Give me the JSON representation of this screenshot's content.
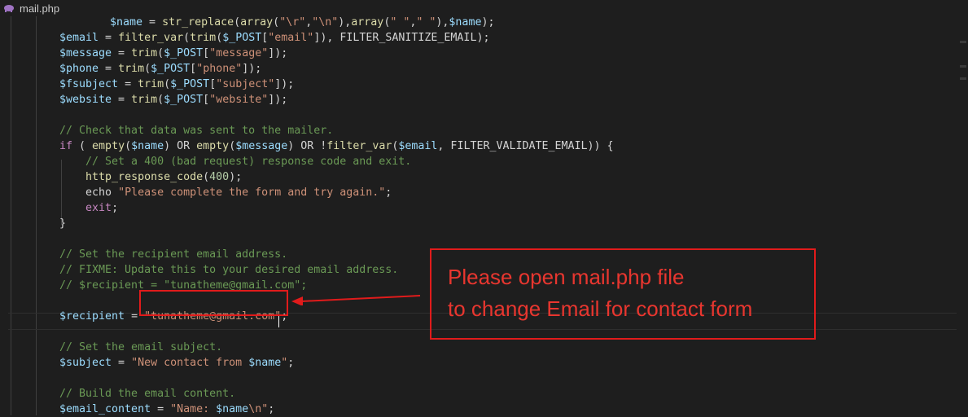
{
  "tab": {
    "filename": "mail.php",
    "icon": "php-elephant-icon"
  },
  "colors": {
    "annotation": "#e11b1b",
    "background": "#1e1e1e"
  },
  "code_lines": [
    [
      {
        "t": "$name",
        "c": "v"
      },
      {
        "t": " = ",
        "c": "p"
      },
      {
        "t": "str_replace",
        "c": "f"
      },
      {
        "t": "(",
        "c": "p"
      },
      {
        "t": "array",
        "c": "f"
      },
      {
        "t": "(",
        "c": "p"
      },
      {
        "t": "\"\\r\"",
        "c": "s"
      },
      {
        "t": ",",
        "c": "p"
      },
      {
        "t": "\"\\n\"",
        "c": "s"
      },
      {
        "t": "),",
        "c": "p"
      },
      {
        "t": "array",
        "c": "f"
      },
      {
        "t": "(",
        "c": "p"
      },
      {
        "t": "\" \"",
        "c": "s"
      },
      {
        "t": ",",
        "c": "p"
      },
      {
        "t": "\" \"",
        "c": "s"
      },
      {
        "t": "),",
        "c": "p"
      },
      {
        "t": "$name",
        "c": "v"
      },
      {
        "t": ");",
        "c": "p"
      }
    ],
    [
      {
        "t": "$email",
        "c": "v"
      },
      {
        "t": " = ",
        "c": "p"
      },
      {
        "t": "filter_var",
        "c": "f"
      },
      {
        "t": "(",
        "c": "p"
      },
      {
        "t": "trim",
        "c": "f"
      },
      {
        "t": "(",
        "c": "p"
      },
      {
        "t": "$_POST",
        "c": "v"
      },
      {
        "t": "[",
        "c": "p"
      },
      {
        "t": "\"email\"",
        "c": "s"
      },
      {
        "t": "]), FILTER_SANITIZE_EMAIL);",
        "c": "p"
      }
    ],
    [
      {
        "t": "$message",
        "c": "v"
      },
      {
        "t": " = ",
        "c": "p"
      },
      {
        "t": "trim",
        "c": "f"
      },
      {
        "t": "(",
        "c": "p"
      },
      {
        "t": "$_POST",
        "c": "v"
      },
      {
        "t": "[",
        "c": "p"
      },
      {
        "t": "\"message\"",
        "c": "s"
      },
      {
        "t": "]);",
        "c": "p"
      }
    ],
    [
      {
        "t": "$phone",
        "c": "v"
      },
      {
        "t": " = ",
        "c": "p"
      },
      {
        "t": "trim",
        "c": "f"
      },
      {
        "t": "(",
        "c": "p"
      },
      {
        "t": "$_POST",
        "c": "v"
      },
      {
        "t": "[",
        "c": "p"
      },
      {
        "t": "\"phone\"",
        "c": "s"
      },
      {
        "t": "]);",
        "c": "p"
      }
    ],
    [
      {
        "t": "$fsubject",
        "c": "v"
      },
      {
        "t": " = ",
        "c": "p"
      },
      {
        "t": "trim",
        "c": "f"
      },
      {
        "t": "(",
        "c": "p"
      },
      {
        "t": "$_POST",
        "c": "v"
      },
      {
        "t": "[",
        "c": "p"
      },
      {
        "t": "\"subject\"",
        "c": "s"
      },
      {
        "t": "]);",
        "c": "p"
      }
    ],
    [
      {
        "t": "$website",
        "c": "v"
      },
      {
        "t": " = ",
        "c": "p"
      },
      {
        "t": "trim",
        "c": "f"
      },
      {
        "t": "(",
        "c": "p"
      },
      {
        "t": "$_POST",
        "c": "v"
      },
      {
        "t": "[",
        "c": "p"
      },
      {
        "t": "\"website\"",
        "c": "s"
      },
      {
        "t": "]);",
        "c": "p"
      }
    ],
    [],
    [
      {
        "t": "// Check that data was sent to the mailer.",
        "c": "c"
      }
    ],
    [
      {
        "t": "if",
        "c": "k"
      },
      {
        "t": " ( ",
        "c": "p"
      },
      {
        "t": "empty",
        "c": "f"
      },
      {
        "t": "(",
        "c": "p"
      },
      {
        "t": "$name",
        "c": "v"
      },
      {
        "t": ") OR ",
        "c": "p"
      },
      {
        "t": "empty",
        "c": "f"
      },
      {
        "t": "(",
        "c": "p"
      },
      {
        "t": "$message",
        "c": "v"
      },
      {
        "t": ") OR !",
        "c": "p"
      },
      {
        "t": "filter_var",
        "c": "f"
      },
      {
        "t": "(",
        "c": "p"
      },
      {
        "t": "$email",
        "c": "v"
      },
      {
        "t": ", FILTER_VALIDATE_EMAIL)) {",
        "c": "p"
      }
    ],
    [
      {
        "t": "    // Set a 400 (bad request) response code and exit.",
        "c": "c"
      }
    ],
    [
      {
        "t": "    ",
        "c": "p"
      },
      {
        "t": "http_response_code",
        "c": "f"
      },
      {
        "t": "(",
        "c": "p"
      },
      {
        "t": "400",
        "c": "n"
      },
      {
        "t": ");",
        "c": "p"
      }
    ],
    [
      {
        "t": "    echo ",
        "c": "p"
      },
      {
        "t": "\"Please complete the form and try again.\"",
        "c": "s"
      },
      {
        "t": ";",
        "c": "p"
      }
    ],
    [
      {
        "t": "    ",
        "c": "p"
      },
      {
        "t": "exit",
        "c": "k"
      },
      {
        "t": ";",
        "c": "p"
      }
    ],
    [
      {
        "t": "}",
        "c": "p"
      }
    ],
    [],
    [
      {
        "t": "// Set the recipient email address.",
        "c": "c"
      }
    ],
    [
      {
        "t": "// FIXME: Update this to your desired email address.",
        "c": "c"
      }
    ],
    [
      {
        "t": "// $recipient = \"tunatheme@gmail.com\";",
        "c": "c"
      }
    ],
    [],
    [
      {
        "t": "$recipient",
        "c": "v"
      },
      {
        "t": " = ",
        "c": "p"
      },
      {
        "t": "\"tunatheme@gmail.com\"",
        "c": "s"
      },
      {
        "t": ";",
        "c": "p"
      }
    ],
    [],
    [
      {
        "t": "// Set the email subject.",
        "c": "c"
      }
    ],
    [
      {
        "t": "$subject",
        "c": "v"
      },
      {
        "t": " = ",
        "c": "p"
      },
      {
        "t": "\"New contact from ",
        "c": "s"
      },
      {
        "t": "$name",
        "c": "v"
      },
      {
        "t": "\"",
        "c": "s"
      },
      {
        "t": ";",
        "c": "p"
      }
    ],
    [],
    [
      {
        "t": "// Build the email content.",
        "c": "c"
      }
    ],
    [
      {
        "t": "$email_content",
        "c": "v"
      },
      {
        "t": " = ",
        "c": "p"
      },
      {
        "t": "\"Name: ",
        "c": "s"
      },
      {
        "t": "$name",
        "c": "v"
      },
      {
        "t": "\\n\"",
        "c": "s"
      },
      {
        "t": ";",
        "c": "p"
      }
    ]
  ],
  "annotation": {
    "line1": "Please open mail.php file",
    "line2": "to change Email for contact form"
  }
}
